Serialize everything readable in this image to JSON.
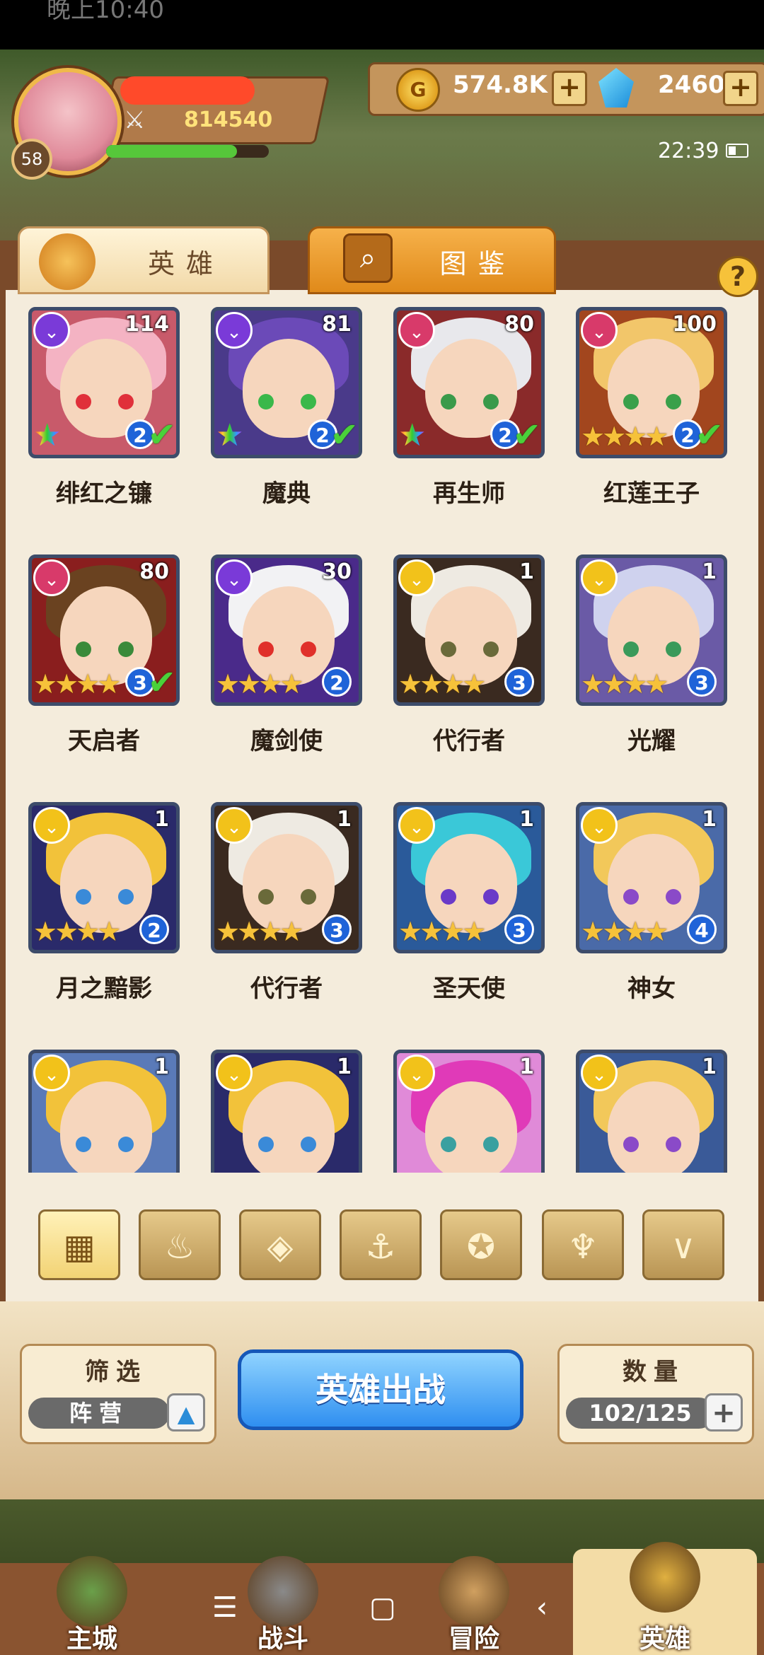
{
  "status_bar": {
    "time": "晚上10:40"
  },
  "player": {
    "level": "58",
    "power": "814540"
  },
  "resources": {
    "coins": "574.8K",
    "gems": "2460",
    "plus": "+",
    "coin_icon_glyph": "G"
  },
  "clock": "22:39",
  "tabs": {
    "heroes": "英雄",
    "collection": "图鉴",
    "help": "?"
  },
  "heroes": [
    {
      "name": "绯红之镰",
      "level": "114",
      "grade": "2",
      "faction": "dark",
      "stars": "rainbow",
      "checked": true,
      "hair": "#f4b3c3",
      "eyes": "#e0303a",
      "bg": "#c85a6a"
    },
    {
      "name": "魔典",
      "level": "81",
      "grade": "2",
      "faction": "dark",
      "stars": "rainbow",
      "checked": true,
      "hair": "#6b4ab8",
      "eyes": "#3ab84a",
      "bg": "#4a3a8a"
    },
    {
      "name": "再生师",
      "level": "80",
      "grade": "2",
      "faction": "fire",
      "stars": "rainbow",
      "checked": true,
      "hair": "#e8e8ec",
      "eyes": "#3a9a4a",
      "bg": "#8a2a2a"
    },
    {
      "name": "红莲王子",
      "level": "100",
      "grade": "2",
      "faction": "fire",
      "stars": "★★★★",
      "checked": true,
      "hair": "#f2c66a",
      "eyes": "#3aa04a",
      "bg": "#a2461e"
    },
    {
      "name": "天启者",
      "level": "80",
      "grade": "3",
      "faction": "fire",
      "stars": "★★★★",
      "checked": true,
      "hair": "#6a4220",
      "eyes": "#3a8a3a",
      "bg": "#8a1e1e"
    },
    {
      "name": "魔剑使",
      "level": "30",
      "grade": "2",
      "faction": "dark",
      "stars": "★★★★",
      "checked": false,
      "hair": "#f2f2f4",
      "eyes": "#e0302a",
      "bg": "#4a2a8a"
    },
    {
      "name": "代行者",
      "level": "1",
      "grade": "3",
      "faction": "light",
      "stars": "★★★★",
      "checked": false,
      "hair": "#eeeae2",
      "eyes": "#6a6a3a",
      "bg": "#3a2a20"
    },
    {
      "name": "光耀",
      "level": "1",
      "grade": "3",
      "faction": "light",
      "stars": "★★★★",
      "checked": false,
      "hair": "#cfd2ee",
      "eyes": "#3a9a5a",
      "bg": "#6a5aa6"
    },
    {
      "name": "月之黯影",
      "level": "1",
      "grade": "2",
      "faction": "light",
      "stars": "★★★★",
      "checked": false,
      "hair": "#f2c23a",
      "eyes": "#3a8ad8",
      "bg": "#2a2a6a"
    },
    {
      "name": "代行者",
      "level": "1",
      "grade": "3",
      "faction": "light",
      "stars": "★★★★",
      "checked": false,
      "hair": "#eeeae2",
      "eyes": "#6a6a3a",
      "bg": "#3a2a20"
    },
    {
      "name": "圣天使",
      "level": "1",
      "grade": "3",
      "faction": "light",
      "stars": "★★★★",
      "checked": false,
      "hair": "#3ac8d8",
      "eyes": "#6a3ac8",
      "bg": "#2a5a9a"
    },
    {
      "name": "神女",
      "level": "1",
      "grade": "4",
      "faction": "light",
      "stars": "★★★★",
      "checked": false,
      "hair": "#f2c85a",
      "eyes": "#8a4ac8",
      "bg": "#4a6aa8"
    },
    {
      "name": "",
      "level": "1",
      "grade": "",
      "faction": "light",
      "stars": "",
      "checked": false,
      "hair": "#f2c23a",
      "eyes": "#3a8ad8",
      "bg": "#5a7ab8"
    },
    {
      "name": "",
      "level": "1",
      "grade": "",
      "faction": "light",
      "stars": "",
      "checked": false,
      "hair": "#f2c23a",
      "eyes": "#3a8ad8",
      "bg": "#2a2a6a"
    },
    {
      "name": "",
      "level": "1",
      "grade": "",
      "faction": "light",
      "stars": "",
      "checked": false,
      "hair": "#e03ab8",
      "eyes": "#3aa0a0",
      "bg": "#e08ad8"
    },
    {
      "name": "",
      "level": "1",
      "grade": "",
      "faction": "light",
      "stars": "",
      "checked": false,
      "hair": "#f2c85a",
      "eyes": "#8a4ac8",
      "bg": "#3a5a98"
    }
  ],
  "faction_colors": {
    "dark": "#7a3ad8",
    "fire": "#d83a6a",
    "light": "#f2c21a"
  },
  "filter_buttons": [
    {
      "icon": "grid-icon",
      "glyph": "▦",
      "active": true
    },
    {
      "icon": "flame-faction-icon",
      "glyph": "♨",
      "active": false
    },
    {
      "icon": "diamond-faction-icon",
      "glyph": "◈",
      "active": false
    },
    {
      "icon": "anchor-icon",
      "glyph": "⚓",
      "active": false
    },
    {
      "icon": "beast-faction-icon",
      "glyph": "✪",
      "active": false
    },
    {
      "icon": "dark-faction-icon",
      "glyph": "♆",
      "active": false
    },
    {
      "icon": "light-faction-icon",
      "glyph": "∨",
      "active": false
    }
  ],
  "bottom": {
    "filter_title": "筛选",
    "camp_label": "阵营",
    "up_glyph": "▲",
    "deploy_label": "英雄出战",
    "count_title": "数量",
    "count_value": "102/125",
    "count_plus": "+"
  },
  "nav": [
    {
      "label": "主城",
      "icon": "castle-icon",
      "active": false
    },
    {
      "label": "战斗",
      "icon": "crossed-swords-icon",
      "active": false
    },
    {
      "label": "冒险",
      "icon": "map-scroll-icon",
      "active": false
    },
    {
      "label": "英雄",
      "icon": "hero-helmet-icon",
      "active": true
    }
  ],
  "system_nav": {
    "menu": "☰",
    "home": "▢",
    "back": "‹"
  }
}
